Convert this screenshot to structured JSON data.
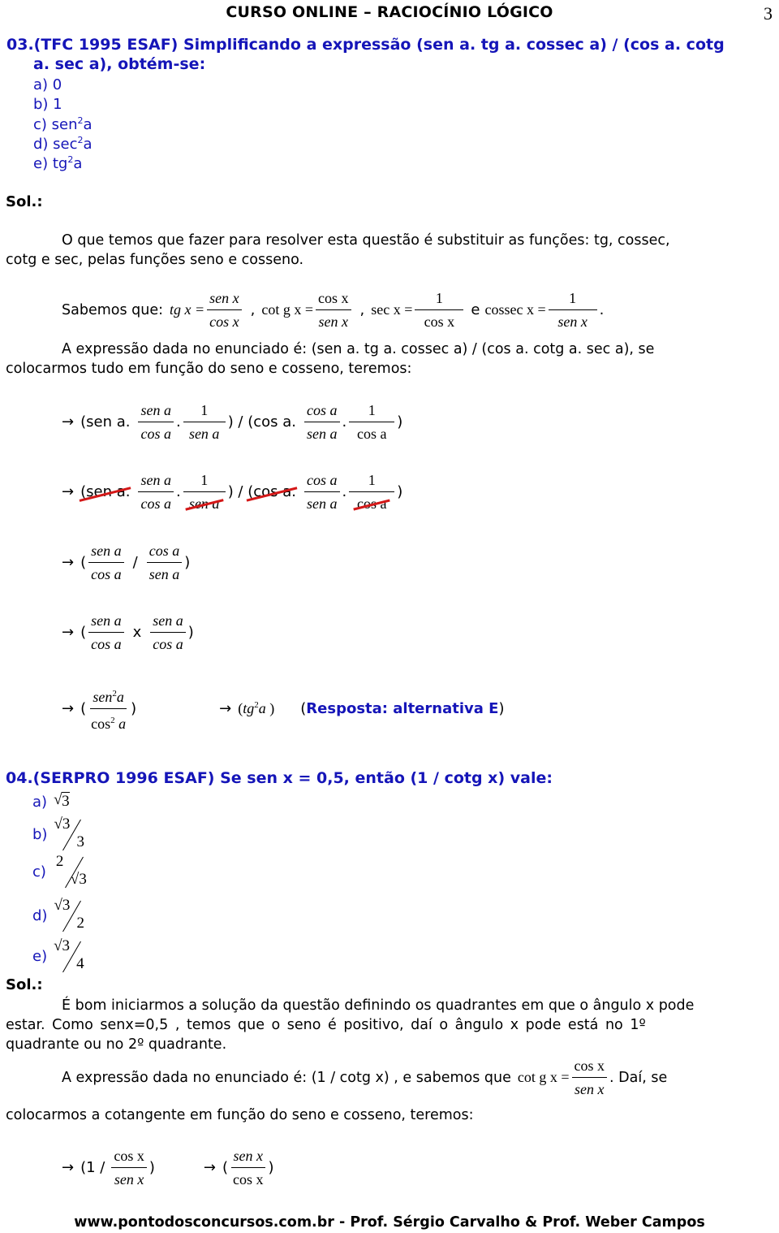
{
  "header": {
    "title": "CURSO ONLINE – RACIOCÍNIO LÓGICO",
    "page_number": "3"
  },
  "q03": {
    "line1": "03.(TFC 1995 ESAF) Simplificando a expressão (sen a. tg a. cossec a) / (cos a. cotg",
    "line2": "a. sec a), obtém-se:",
    "options": [
      {
        "label": "a) 0"
      },
      {
        "label": "b) 1"
      },
      {
        "label": "c) sen",
        "sup": "2",
        "tail": "a"
      },
      {
        "label": "d) sec",
        "sup": "2",
        "tail": "a"
      },
      {
        "label": "e) tg",
        "sup": "2",
        "tail": "a"
      }
    ],
    "sol_label": "Sol.:",
    "para1_line1": "O que temos que fazer para resolver esta questão é substituir as funções: tg, cossec,",
    "para1_line2": "cotg e sec, pelas funções seno e cosseno.",
    "sabemos_label": "Sabemos que:",
    "identities": {
      "tg_lhs": "tg x =",
      "tg_num": "sen x",
      "tg_den": "cos x",
      "cotg_lhs": "cot g x =",
      "cotg_num": "cos x",
      "cotg_den": "sen x",
      "sec_lhs": "sec x =",
      "sec_num": "1",
      "sec_den": "cos x",
      "e": "e",
      "cossec_lhs": "cossec x =",
      "cossec_num": "1",
      "cossec_den": "sen x"
    },
    "para2_line1": "A expressão dada no enunciado é:  (sen a. tg a. cossec a) / (cos a. cotg a. sec a), se",
    "para2_line2": "colocarmos tudo em função do seno e cosseno, teremos:",
    "steps": {
      "arrow": "→",
      "open_sen": "(sen a.",
      "open_cos": "(cos a.",
      "sen_a": "sen a",
      "cos_a": "cos a",
      "one": "1",
      "mid": ") / ",
      "close": ")",
      "dot": ".",
      "open": "(",
      "slash": "/",
      "times": "x",
      "sen2a": "sen",
      "cos2a": "cos",
      "sq": "2",
      "a": "a",
      "tg2a": "tg",
      "answer": "Resposta: alternativa E"
    }
  },
  "q04": {
    "title": "04.(SERPRO 1996 ESAF) Se sen x = 0,5, então (1 / cotg x) vale:",
    "options": [
      {
        "label": "a)",
        "top": "3",
        "bottom": ""
      },
      {
        "label": "b)",
        "top": "√3",
        "bottom": "3"
      },
      {
        "label": "c)",
        "top": "2",
        "bottom": "√3"
      },
      {
        "label": "d)",
        "top": "√3",
        "bottom": "2"
      },
      {
        "label": "e)",
        "top": "√3",
        "bottom": "4"
      }
    ],
    "sol_label": "Sol.:",
    "para1_line1": "É bom iniciarmos a solução da questão definindo os quadrantes em que o ângulo x pode",
    "para1_line2": "estar. Como senx=0,5 , temos que o seno é positivo, daí o ângulo x pode está no 1º",
    "para1_line3": "quadrante ou no 2º quadrante.",
    "para2_pre": "A expressão dada no enunciado é: (1 / cotg x) , e sabemos que",
    "cotg_lhs": "cot g x =",
    "cotg_num": "cos x",
    "cotg_den": "sen x",
    "para2_post": ". Daí, se",
    "para2_line2": "colocarmos a cotangente em função do seno e cosseno, teremos:",
    "steps": {
      "arrow": "→",
      "open1": "(1 /",
      "open": "(",
      "close": ")",
      "cos_x": "cos x",
      "sen_x": "sen x"
    }
  },
  "footer": {
    "text": "www.pontodosconcursos.com.br  -  Prof. Sérgio Carvalho & Prof. Weber Campos"
  },
  "colors": {
    "question_blue": "#1515b8",
    "strike_red": "#d41818"
  }
}
